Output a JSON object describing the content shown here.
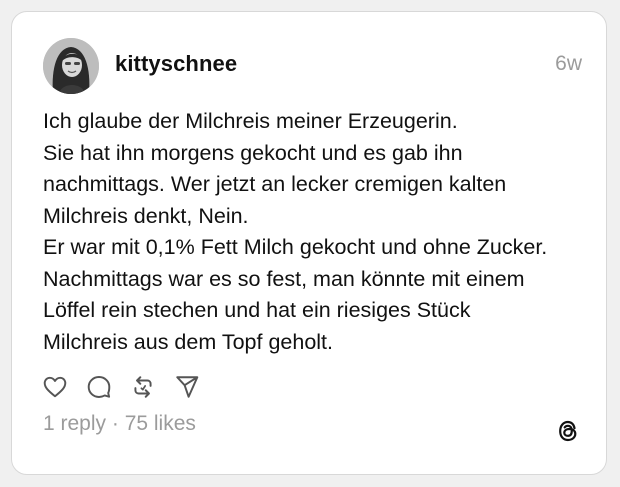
{
  "post": {
    "username": "kittyschnee",
    "timestamp": "6w",
    "lines": [
      "Ich glaube der Milchreis meiner Erzeugerin.",
      "Sie hat ihn morgens gekocht und es gab ihn",
      "nachmittags. Wer jetzt an lecker cremigen kalten",
      "Milchreis denkt, Nein.",
      "Er war mit 0,1% Fett Milch gekocht und ohne Zucker.",
      "Nachmittags war es so fest, man könnte mit einem",
      "Löffel rein stechen und hat ein riesiges Stück",
      "Milchreis aus dem Topf geholt."
    ],
    "stats": "1 reply · 75 likes"
  },
  "icons": {
    "like": "heart-icon",
    "reply": "comment-icon",
    "repost": "repost-icon",
    "share": "send-icon",
    "brand": "threads-logo-icon"
  },
  "colors": {
    "text": "#111111",
    "muted": "#9b9b9b",
    "card_border": "#d8d8d8",
    "background": "#f0f0f0"
  }
}
